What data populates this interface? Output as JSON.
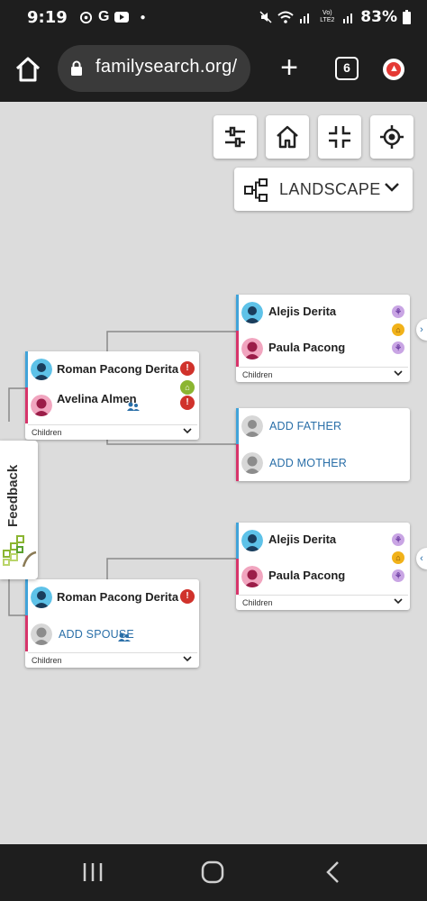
{
  "status_bar": {
    "time": "9:19",
    "left_icons": [
      "sync-icon",
      "google-icon",
      "youtube-icon",
      "dot-icon"
    ],
    "network": "Vo) LTE2",
    "battery": "83%"
  },
  "browser": {
    "url": "familysearch.org/",
    "tab_count": "6"
  },
  "toolbar": {
    "orientation_label": "LANDSCAPE"
  },
  "cards": {
    "focus_couple": {
      "husband": "Roman Pacong Derita",
      "wife": "Avelina Almen",
      "children_label": "Children"
    },
    "parents_top": {
      "father": "Alejis Derita",
      "mother": "Paula Pacong",
      "children_label": "Children"
    },
    "wife_parents": {
      "add_father": "ADD FATHER",
      "add_mother": "ADD MOTHER"
    },
    "parents_bottom": {
      "father": "Alejis Derita",
      "mother": "Paula Pacong",
      "children_label": "Children"
    },
    "second_couple": {
      "husband": "Roman Pacong Derita",
      "add_spouse": "ADD SPOUSE",
      "children_label": "Children"
    }
  },
  "feedback": {
    "label": "Feedback"
  },
  "colors": {
    "male_bar": "#41a3d9",
    "female_bar": "#d7356b",
    "alert": "#d0322b",
    "link": "#2a6fa8"
  }
}
